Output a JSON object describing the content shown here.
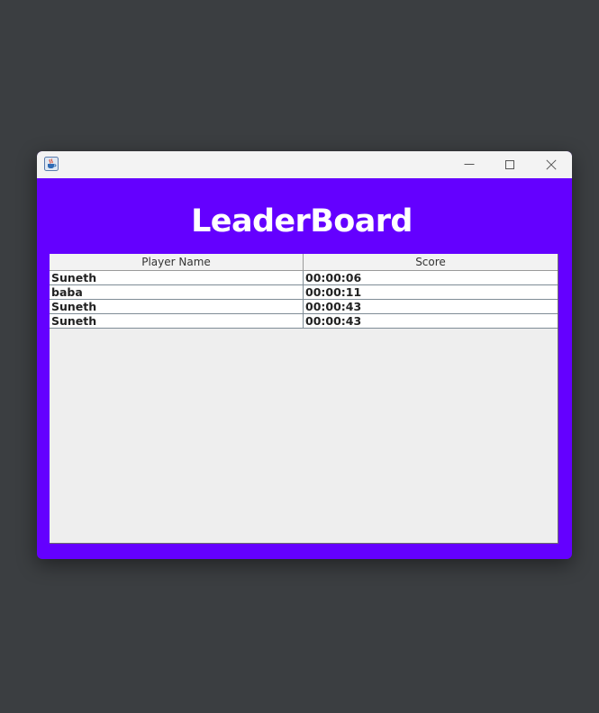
{
  "window": {
    "app_icon": "java-cup-icon",
    "controls": {
      "minimize_icon": "minimize-icon",
      "maximize_icon": "maximize-icon",
      "close_icon": "close-icon"
    }
  },
  "page": {
    "title": "LeaderBoard",
    "background_color": "#6400ff"
  },
  "table": {
    "columns": [
      "Player Name",
      "Score"
    ],
    "rows": [
      [
        "Suneth",
        "00:00:06"
      ],
      [
        "baba",
        "00:00:11"
      ],
      [
        "Suneth",
        "00:00:43"
      ],
      [
        "Suneth",
        "00:00:43"
      ]
    ]
  }
}
